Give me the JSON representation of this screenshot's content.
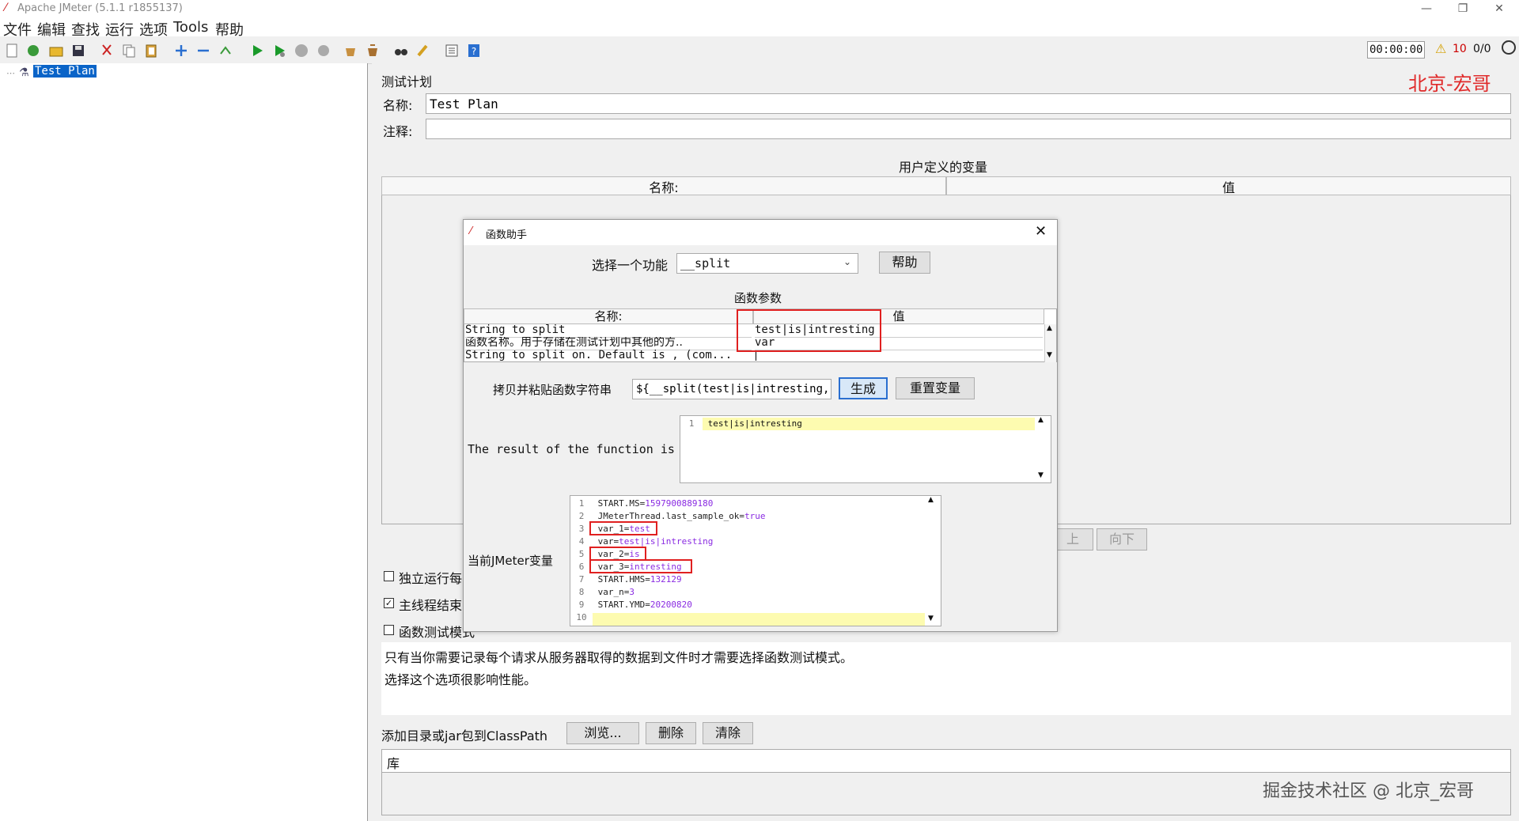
{
  "window": {
    "title": "Apache JMeter (5.1.1 r1855137)",
    "minimize": "—",
    "restore": "❐",
    "close": "✕"
  },
  "menu": [
    "文件",
    "编辑",
    "查找",
    "运行",
    "选项",
    "Tools",
    "帮助"
  ],
  "toolbar": {
    "timer": "00:00:00",
    "warning_count": "10",
    "thread_count": "0/0"
  },
  "tree": {
    "root_label": "Test Plan"
  },
  "plan": {
    "section_title": "测试计划",
    "brand_watermark": "北京-宏哥",
    "name_label": "名称:",
    "name_value": "Test Plan",
    "comment_label": "注释:",
    "comment_value": "",
    "udv_title": "用户定义的变量",
    "udv_col_name": "名称:",
    "udv_col_value": "值",
    "btn_up": "上",
    "btn_down": "向下",
    "checkbox_independent": "独立运行每",
    "checkbox_main_thread": "主线程结束",
    "checkbox_functional": "函数测试模式",
    "functional_note_1": "只有当你需要记录每个请求从服务器取得的数据到文件时才需要选择函数测试模式。",
    "functional_note_2": "选择这个选项很影响性能。",
    "classpath_label": "添加目录或jar包到ClassPath",
    "btn_browse": "浏览...",
    "btn_delete": "删除",
    "btn_clear": "清除",
    "lib_header": "库",
    "footer_watermark": "掘金技术社区 @ 北京_宏哥"
  },
  "dialog": {
    "title": "函数助手",
    "select_label": "选择一个功能",
    "function_value": "__split",
    "help_button": "帮助",
    "params_title": "函数参数",
    "col_name": "名称:",
    "col_value": "值",
    "params": [
      {
        "name": "String to split",
        "value": "test|is|intresting"
      },
      {
        "name": "函数名称。用于存储在测试计划中其他的方..",
        "value": "var"
      },
      {
        "name": "String to split on. Default is , (com...",
        "value": ""
      }
    ],
    "copy_label": "拷贝并粘贴函数字符串",
    "function_string": "${__split(test|is|intresting,var,|)}",
    "generate_button": "生成",
    "reset_button": "重置变量",
    "result_label": "The result of the function is",
    "result_lines": [
      "test|is|intresting"
    ],
    "vars_label": "当前JMeter变量",
    "vars": [
      {
        "k": "START.MS=",
        "v": "1597900889180"
      },
      {
        "k": "JMeterThread.last_sample_ok=",
        "v": "true"
      },
      {
        "k": "var_1=",
        "v": "test"
      },
      {
        "k": "var=",
        "v": "test|is|intresting"
      },
      {
        "k": "var_2=",
        "v": "is"
      },
      {
        "k": "var_3=",
        "v": "intresting"
      },
      {
        "k": "START.HMS=",
        "v": "132129"
      },
      {
        "k": "var_n=",
        "v": "3"
      },
      {
        "k": "START.YMD=",
        "v": "20200820"
      },
      {
        "k": "",
        "v": ""
      }
    ]
  }
}
